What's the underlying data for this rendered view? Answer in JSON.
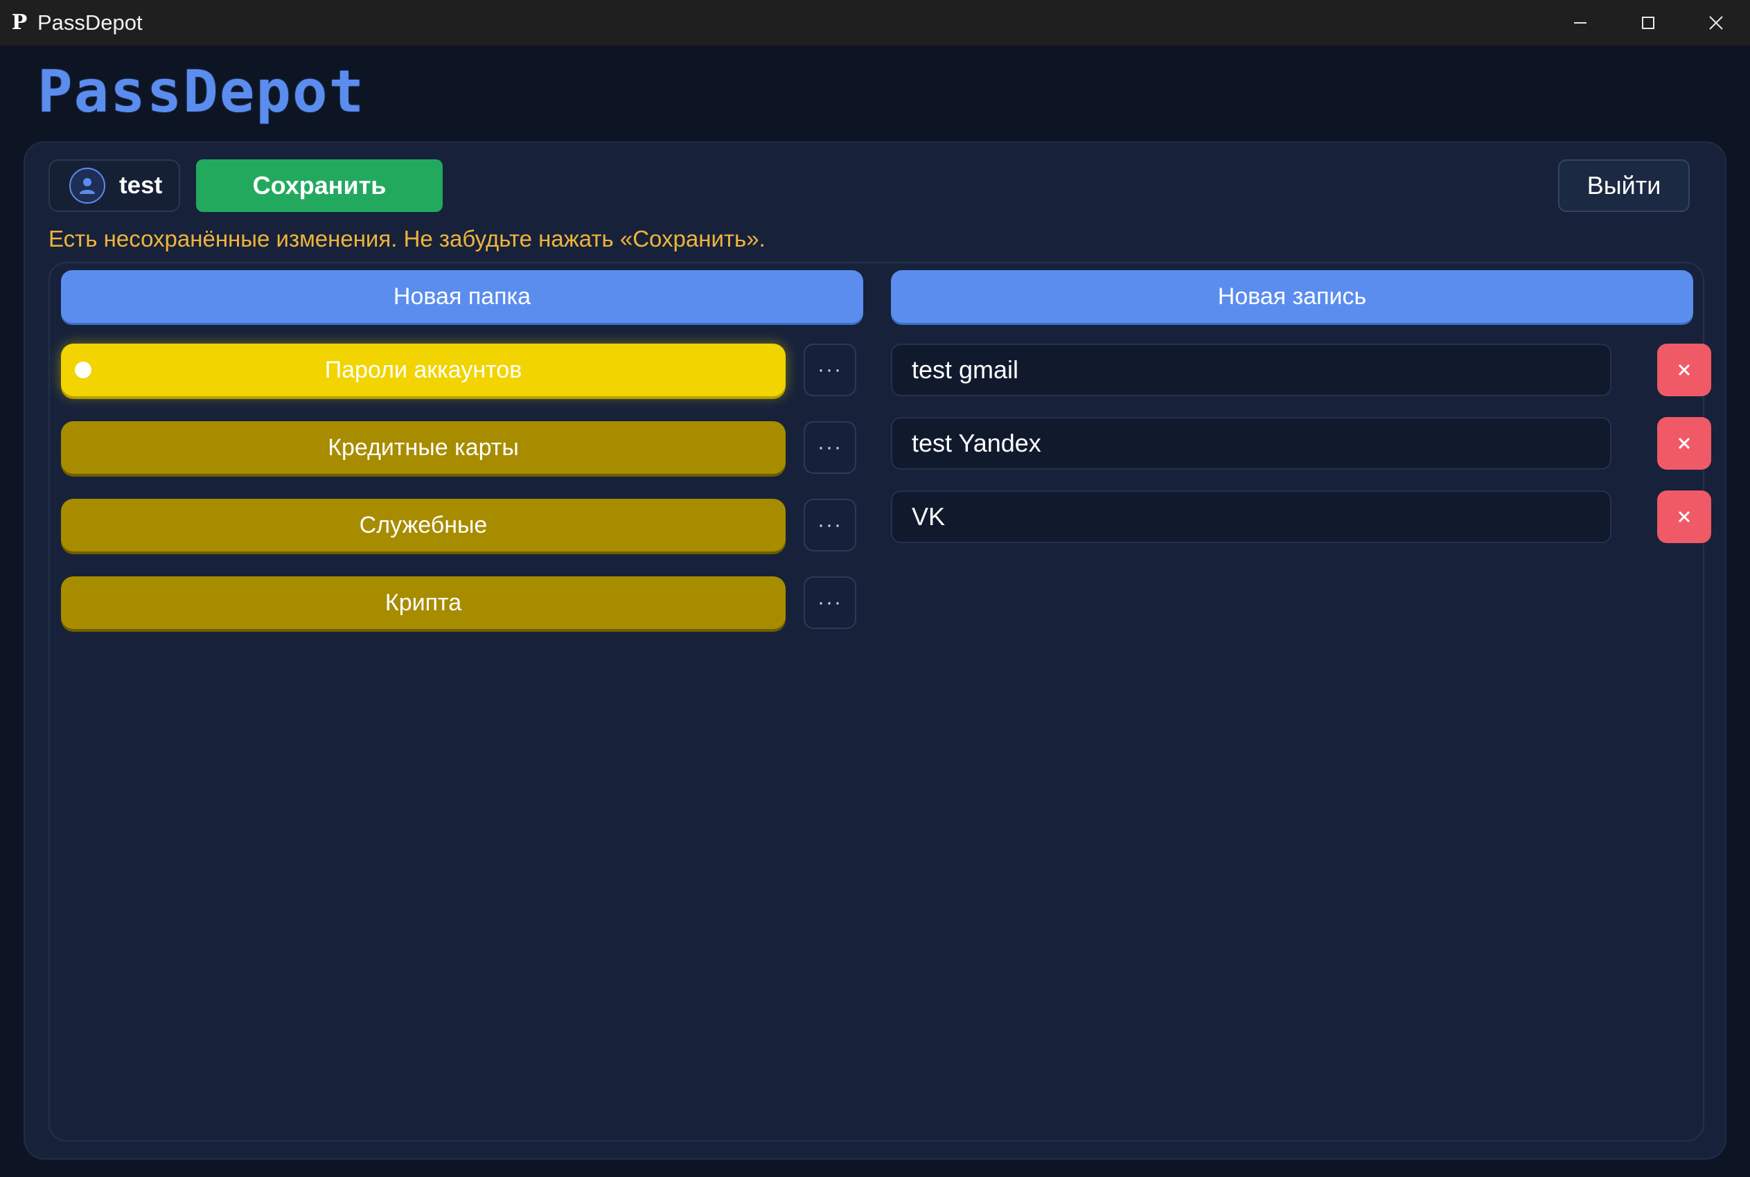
{
  "window": {
    "title": "PassDepot",
    "app_glyph": "P"
  },
  "logo": "PassDepot",
  "toolbar": {
    "username": "test",
    "save_label": "Сохранить",
    "logout_label": "Выйти"
  },
  "warning": "Есть несохранённые изменения. Не забудьте нажать «Сохранить».",
  "folders": {
    "new_folder_label": "Новая папка",
    "items": [
      {
        "label": "Пароли аккаунтов",
        "active": true
      },
      {
        "label": "Кредитные карты",
        "active": false
      },
      {
        "label": "Служебные",
        "active": false
      },
      {
        "label": "Крипта",
        "active": false
      }
    ],
    "more_glyph": "···"
  },
  "entries": {
    "new_entry_label": "Новая запись",
    "items": [
      {
        "label": "test gmail"
      },
      {
        "label": "test Yandex"
      },
      {
        "label": "VK"
      }
    ]
  },
  "colors": {
    "accent": "#5b8def",
    "save": "#22a95e",
    "folder": "#a88c00",
    "folder_active": "#f1d400",
    "delete": "#ef5a66",
    "warning": "#f0b43c"
  },
  "icons": {
    "user": "user-icon",
    "delete": "close-icon",
    "more": "more-icon"
  }
}
